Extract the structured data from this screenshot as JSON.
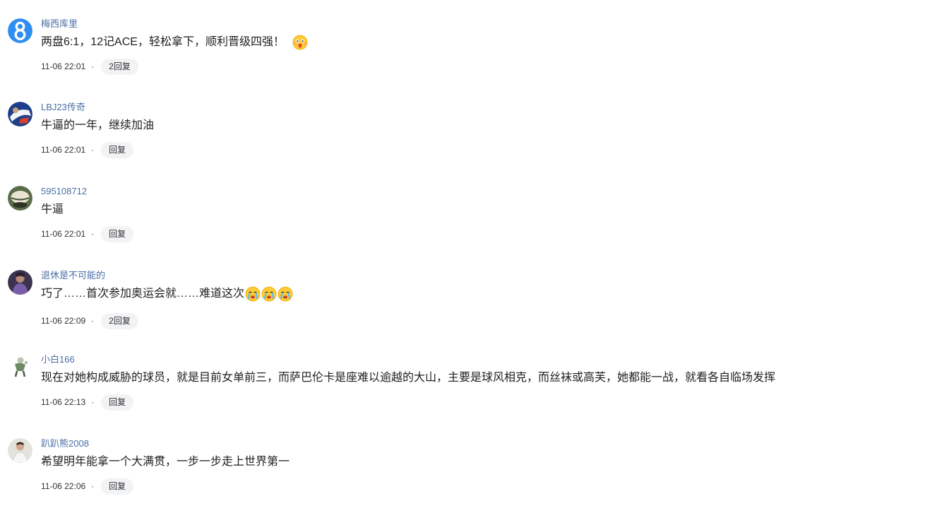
{
  "comments": [
    {
      "avatar": "blue-8-avatar",
      "user": "梅西库里",
      "text": "两盘6:1，12记ACE，轻松拿下，顺利晋级四强！",
      "emojis": [
        "shocked-face-icon"
      ],
      "time": "11-06 22:01",
      "reply_label": "2回复"
    },
    {
      "avatar": "photo-avatar-blue",
      "user": "LBJ23传奇",
      "text": "牛逼的一年，继续加油",
      "emojis": [],
      "time": "11-06 22:01",
      "reply_label": "回复"
    },
    {
      "avatar": "photo-avatar-green",
      "user": "595108712",
      "text": "牛逼",
      "emojis": [],
      "time": "11-06 22:01",
      "reply_label": "回复"
    },
    {
      "avatar": "photo-avatar-purple",
      "user": "退休是不可能的",
      "text": "巧了……首次参加奥运会就……难道这次",
      "emojis": [
        "crying-face-icon",
        "crying-face-icon",
        "crying-face-icon"
      ],
      "time": "11-06 22:09",
      "reply_label": "2回复"
    },
    {
      "avatar": "photo-avatar-figure",
      "user": "小白166",
      "text": "现在对她构成威胁的球员，就是目前女单前三，而萨巴伦卡是座难以逾越的大山，主要是球风相克，而丝袜或高芙，她都能一战，就看各自临场发挥",
      "emojis": [],
      "time": "11-06 22:13",
      "reply_label": "回复"
    },
    {
      "avatar": "photo-avatar-person",
      "user": "趴趴熊2008",
      "text": "希望明年能拿一个大满贯，一步一步走上世界第一",
      "emojis": [],
      "time": "11-06 22:06",
      "reply_label": "回复"
    }
  ],
  "separator": "·",
  "colors": {
    "username": "#4a6fa5",
    "reply_bg": "#f2f3f5",
    "text": "#1f1f1f"
  }
}
